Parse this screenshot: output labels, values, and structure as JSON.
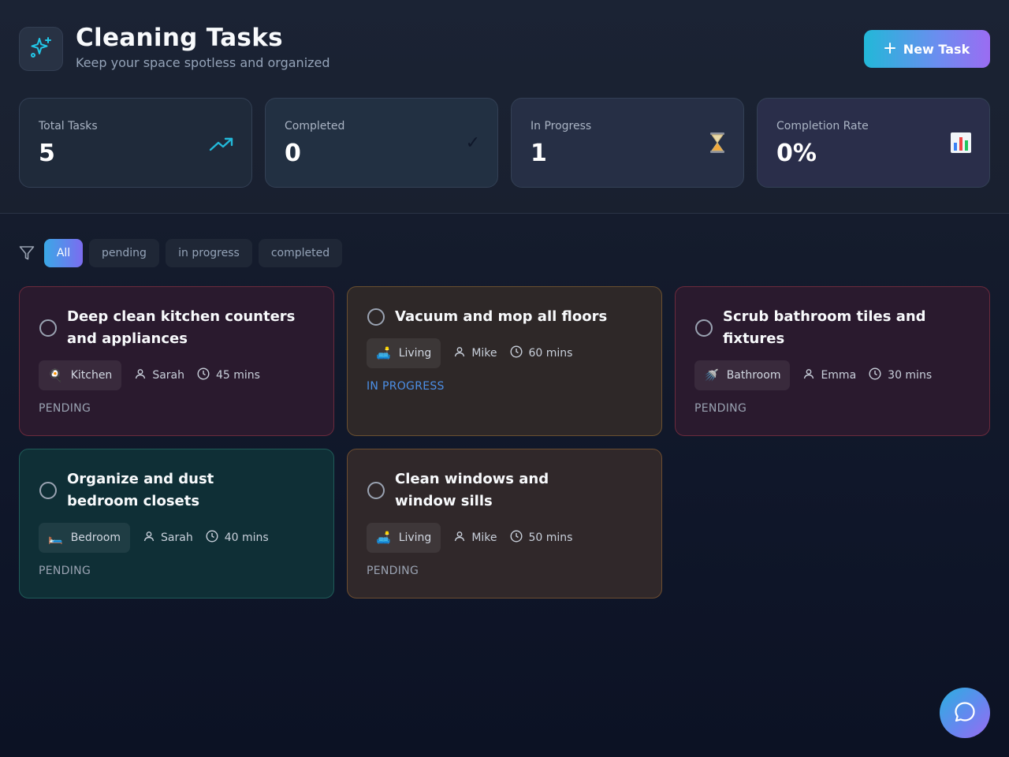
{
  "header": {
    "title": "Cleaning Tasks",
    "subtitle": "Keep your space spotless and organized",
    "logo_icon": "sparkles-icon",
    "new_task_label": "New Task"
  },
  "stats": [
    {
      "label": "Total Tasks",
      "value": "5",
      "icon": "trending-up-icon"
    },
    {
      "label": "Completed",
      "value": "0",
      "icon": "check-icon"
    },
    {
      "label": "In Progress",
      "value": "1",
      "icon": "hourglass-icon"
    },
    {
      "label": "Completion Rate",
      "value": "0%",
      "icon": "bar-chart-icon"
    }
  ],
  "filters": {
    "icon": "filter-icon",
    "options": [
      "All",
      "pending",
      "in progress",
      "completed"
    ],
    "selected": "All"
  },
  "tasks": [
    {
      "title": "Deep clean kitchen counters and appliances",
      "room": "Kitchen",
      "room_emoji": "🍳",
      "assignee": "Sarah",
      "duration": "45 mins",
      "status": "PENDING",
      "color": "#6b2a3c"
    },
    {
      "title": "Vacuum and mop all floors",
      "room": "Living",
      "room_emoji": "🛋️",
      "assignee": "Mike",
      "duration": "60 mins",
      "status": "IN PROGRESS",
      "color": "#6a5030"
    },
    {
      "title": "Scrub bathroom tiles and fixtures",
      "room": "Bathroom",
      "room_emoji": "🚿",
      "assignee": "Emma",
      "duration": "30 mins",
      "status": "PENDING",
      "color": "#6b2a3c"
    },
    {
      "title": "Organize and dust bedroom closets",
      "room": "Bedroom",
      "room_emoji": "🛏️",
      "assignee": "Sarah",
      "duration": "40 mins",
      "status": "PENDING",
      "color": "#1f5b58"
    },
    {
      "title": "Clean windows and window sills",
      "room": "Living",
      "room_emoji": "🛋️",
      "assignee": "Mike",
      "duration": "50 mins",
      "status": "PENDING",
      "color": "#6d4d30"
    }
  ],
  "chat_icon": "chat-bubble-icon",
  "colors": {
    "accent_cyan": "#22b8d8",
    "accent_purple": "#9b6cf2",
    "in_progress": "#4c8fe6"
  }
}
